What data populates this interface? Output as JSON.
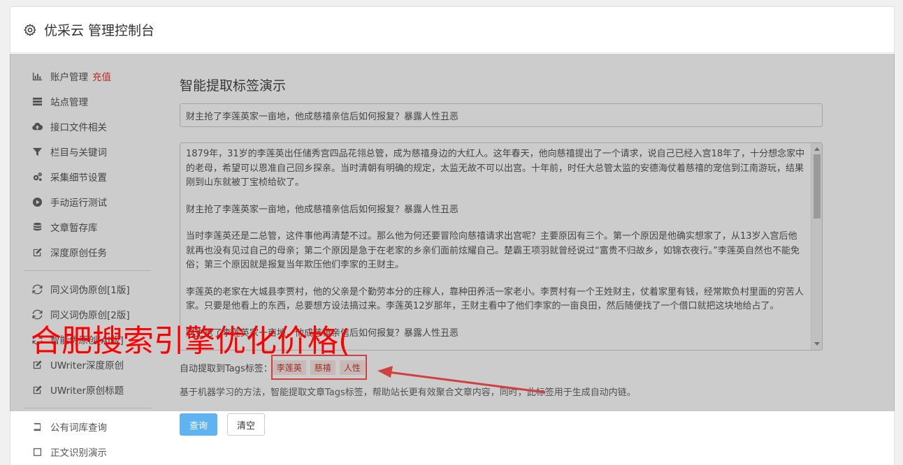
{
  "header": {
    "title": "优采云 管理控制台",
    "icon": "gear-icon"
  },
  "sidebar": {
    "group1": [
      {
        "label": "账户管理",
        "badge": "充值",
        "icon": "bar-chart-icon"
      },
      {
        "label": "站点管理",
        "icon": "list-icon"
      },
      {
        "label": "接口文件相关",
        "icon": "cloud-upload-icon"
      },
      {
        "label": "栏目与关键词",
        "icon": "filter-icon"
      },
      {
        "label": "采集细节设置",
        "icon": "cogs-icon"
      },
      {
        "label": "手动运行测试",
        "icon": "play-icon"
      },
      {
        "label": "文章暂存库",
        "icon": "database-icon"
      },
      {
        "label": "深度原创任务",
        "icon": "edit-icon"
      }
    ],
    "group2": [
      {
        "label": "同义词伪原创[1版]",
        "icon": "refresh-icon"
      },
      {
        "label": "同义词伪原创[2版]",
        "icon": "refresh-icon"
      },
      {
        "label": "智能伪原创[AI版]",
        "icon": "refresh-icon"
      },
      {
        "label": "UWriter深度原创",
        "icon": "edit-icon"
      },
      {
        "label": "UWriter原创标题",
        "icon": "edit-icon"
      }
    ],
    "group3": [
      {
        "label": "公有词库查询",
        "icon": "book-icon"
      },
      {
        "label": "正文识别演示",
        "icon": "square-icon"
      }
    ]
  },
  "main": {
    "heading": "智能提取标签演示",
    "title_value": "财主抢了李莲英家一亩地，他成慈禧亲信后如何报复？暴露人性丑恶",
    "content_paragraphs": [
      "1879年，31岁的李莲英出任储秀宫四品花翎总管，成为慈禧身边的大红人。这年春天，他向慈禧提出了一个请求，说自己已经入宫18年了，十分想念家中的老母，希望可以恩准自己回乡探亲。当时清朝有明确的规定，太监无故不可以出宫。十年前，时任大总管太监的安德海仗着慈禧的宠信到江南游玩，结果刚到山东就被丁宝桢给砍了。",
      "财主抢了李莲英家一亩地，他成慈禧亲信后如何报复？暴露人性丑恶",
      "当时李莲英还是二总管，这件事他再清楚不过。那么他为何还要冒险向慈禧请求出宫呢？主要原因有三个。第一个原因是他确实想家了，从13岁入宫后他就再也没有见过自己的母亲；第二个原因是急于在老家的乡亲们面前炫耀自己。楚霸王项羽就曾经说过“富贵不归故乡，如锦衣夜行。”李莲英自然也不能免俗；第三个原因就是报复当年欺压他们李家的王财主。",
      "李莲英的老家在大城县李贾村，他的父亲是个勤劳本分的庄稼人，靠种田养活一家老小。李贾村有一个王姓财主，仗着家里有钱，经常欺负村里面的穷苦人家。只要是他看上的东西，总要想方设法搞过来。李莲英12岁那年，王财主看中了他们李家的一亩良田，然后随便找了一个借口就把这块地给占了。",
      "财主抢了李莲英家一亩地，他成慈禧亲信后如何报复？暴露人性丑恶"
    ],
    "tags_label": "自动提取到Tags标签：",
    "tags": [
      "李莲英",
      "慈禧",
      "人性"
    ],
    "description": "基于机器学习的方法，智能提取文章Tags标签，帮助站长更有效聚合文章内容，同时，此标签用于生成自动内链。",
    "query_button": "查询",
    "clear_button": "清空"
  },
  "watermark": "合肥搜索引擎优化价格(",
  "colors": {
    "accent": "#5fb3f0",
    "badge_red": "#e5352b",
    "watermark_red": "#ff0000"
  }
}
